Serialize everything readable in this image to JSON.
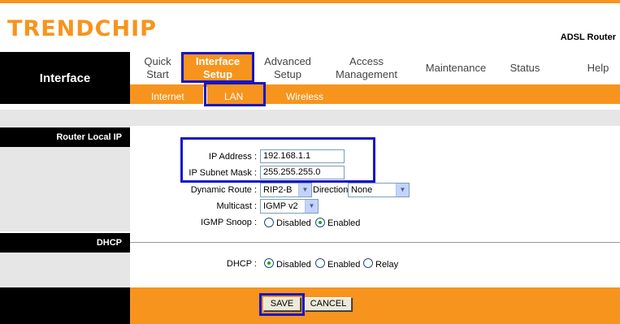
{
  "header": {
    "logo": "TRENDCHIP",
    "model": "ADSL Router"
  },
  "nav": {
    "section_title": "Interface",
    "items": [
      {
        "line1": "Quick",
        "line2": "Start"
      },
      {
        "line1": "Interface",
        "line2": "Setup",
        "active": true
      },
      {
        "line1": "Advanced",
        "line2": "Setup"
      },
      {
        "line1": "Access",
        "line2": "Management"
      },
      {
        "line1": "Maintenance",
        "line2": ""
      },
      {
        "line1": "Status",
        "line2": ""
      },
      {
        "line1": "Help",
        "line2": ""
      }
    ],
    "sub_items": [
      "Internet",
      "LAN",
      "Wireless"
    ],
    "active_sub": "LAN"
  },
  "router_local_ip": {
    "heading": "Router Local IP",
    "ip_address_label": "IP Address :",
    "ip_address": "192.168.1.1",
    "subnet_label": "IP Subnet Mask :",
    "subnet": "255.255.255.0",
    "dynamic_route_label": "Dynamic Route :",
    "dynamic_route": "RIP2-B",
    "direction_label": "Direction",
    "direction": "None",
    "multicast_label": "Multicast :",
    "multicast": "IGMP v2",
    "igmp_snoop_label": "IGMP Snoop :",
    "igmp_options": [
      "Disabled",
      "Enabled"
    ],
    "igmp_selected": "Enabled"
  },
  "dhcp": {
    "heading": "DHCP",
    "label": "DHCP :",
    "options": [
      "Disabled",
      "Enabled",
      "Relay"
    ],
    "selected": "Disabled"
  },
  "buttons": {
    "save": "SAVE",
    "cancel": "CANCEL"
  },
  "colors": {
    "accent": "#f7941d",
    "highlight": "#1515c8",
    "sidebar": "#000000",
    "panel": "#e6e6e6"
  }
}
